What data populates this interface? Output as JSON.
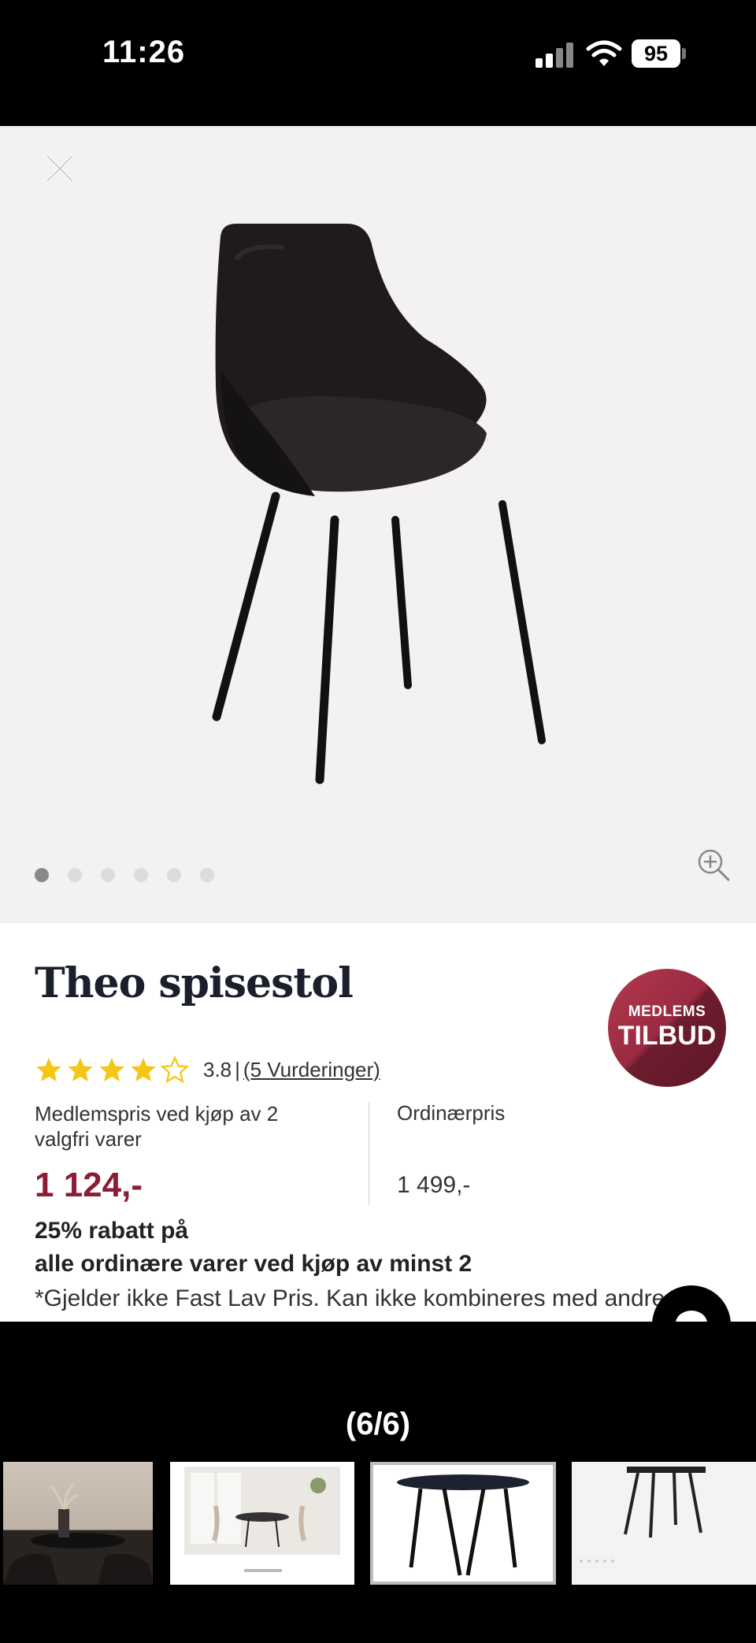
{
  "status_bar": {
    "time": "11:26",
    "battery": "95"
  },
  "gallery": {
    "dots_count": 6,
    "active_dot": 0
  },
  "product": {
    "title": "Theo spisestol",
    "badge_line1": "MEDLEMS",
    "badge_line2": "TILBUD",
    "rating_value": "3.8",
    "rating_stars": 3.8,
    "rating_separator": "|",
    "reviews_link": "(5 Vurderinger)",
    "member_price_label": "Medlemspris ved kjøp av 2 valgfri varer",
    "ordinary_price_label": "Ordinærpris",
    "member_price": "1 124,-",
    "ordinary_price": "1 499,-",
    "promo_line1": "25% rabatt på",
    "promo_line2": "alle ordinære varer ved kjøp av minst 2",
    "disclaimer": "*Gjelder ikke Fast Lav Pris. Kan ikke kombineres med andre"
  },
  "viewer": {
    "counter": "(6/6)"
  },
  "colors": {
    "price_accent": "#8b1d35",
    "star": "#f5c518",
    "hero_bg": "#f3f2f0"
  }
}
